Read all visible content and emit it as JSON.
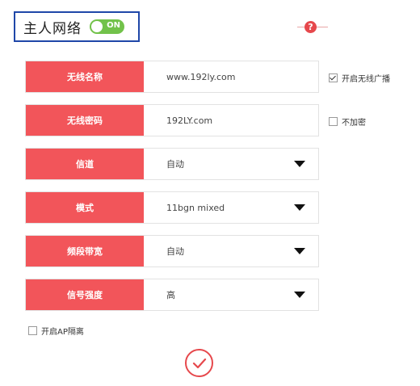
{
  "header": {
    "title": "主人网络",
    "toggle_label": "ON"
  },
  "help": {
    "icon": "question-circle-icon",
    "glyph": "?"
  },
  "form": {
    "ssid": {
      "label": "无线名称",
      "value": "www.192ly.com"
    },
    "password": {
      "label": "无线密码",
      "value": "192LY.com"
    },
    "channel": {
      "label": "信道",
      "value": "自动"
    },
    "mode": {
      "label": "模式",
      "value": "11bgn mixed"
    },
    "bandwidth": {
      "label": "频段带宽",
      "value": "自动"
    },
    "signal": {
      "label": "信号强度",
      "value": "高"
    }
  },
  "options": {
    "broadcast": {
      "label": "开启无线广播",
      "checked": true
    },
    "no_encrypt": {
      "label": "不加密",
      "checked": false
    },
    "ap_isolation": {
      "label": "开启AP隔离",
      "checked": false
    }
  },
  "colors": {
    "accent": "#f2555a",
    "toggle_on": "#72c24a",
    "header_border": "#1f47a8"
  }
}
